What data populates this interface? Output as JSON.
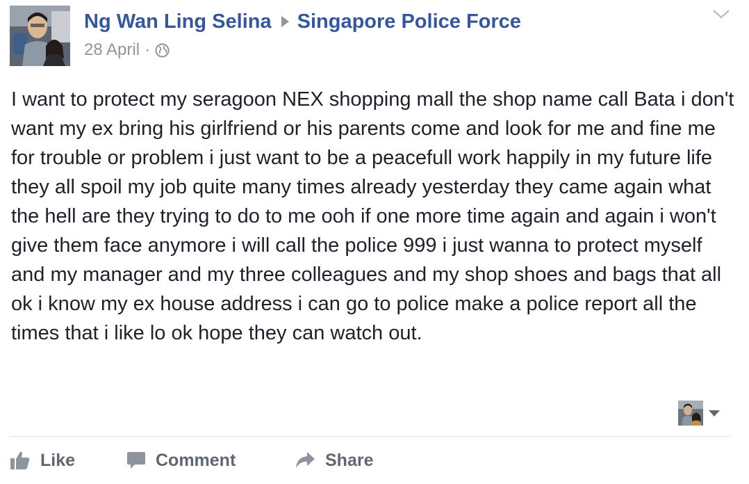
{
  "post": {
    "author_name": "Ng Wan Ling Selina",
    "target_page": "Singapore Police Force",
    "date": "28 April",
    "separator": "·",
    "privacy_icon": "globe-icon",
    "options_icon": "chevron-down-icon",
    "text": "I want to protect my seragoon NEX shopping mall the shop name call Bata i don't want my ex bring his girlfriend or his parents come and look for me and fine me for trouble or problem i just want to be a peacefull work happily in my future life they all spoil my job quite many times already yesterday they came again what the hell are they trying to do to me ooh if one more time again and again i won't give them face anymore i will call the police 999 i just wanna to protect myself and my manager and my three colleagues and my shop shoes and bags that all ok i know my ex house address i can go to police make a police report all the times that i like lo ok hope they can watch out."
  },
  "actions": {
    "like_label": "Like",
    "comment_label": "Comment",
    "share_label": "Share"
  },
  "colors": {
    "link_blue": "#365899",
    "meta_gray": "#90949c",
    "body_text": "#1d2129",
    "action_gray": "#616770",
    "divider": "#dddfe2"
  }
}
